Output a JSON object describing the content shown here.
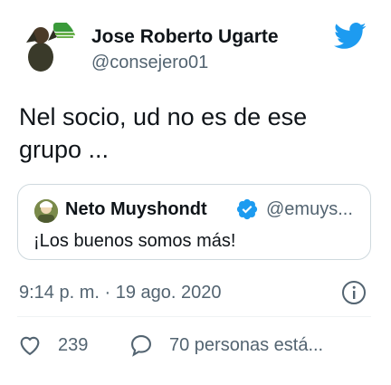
{
  "tweet": {
    "author": {
      "display_name": "Jose Roberto Ugarte",
      "handle": "@consejero01",
      "avatar_icon": "profile-photo-avatar"
    },
    "platform_icon": "twitter-bird-icon",
    "text": "Nel socio, ud no es de ese grupo ...",
    "quoted_tweet": {
      "display_name": "Neto Muyshondt",
      "handle": "@emuys...",
      "verified": true,
      "verified_color": "#1d9bf0",
      "text": "¡Los buenos somos más!"
    },
    "timestamp": "9:14 p. m. · 19 ago. 2020",
    "info_icon": "info-icon",
    "actions": {
      "like_count": "239",
      "reply_label": "70 personas está..."
    }
  },
  "colors": {
    "accent": "#1d9bf0",
    "text_primary": "#0f1419",
    "text_secondary": "#536471",
    "border": "#cfd9de"
  }
}
